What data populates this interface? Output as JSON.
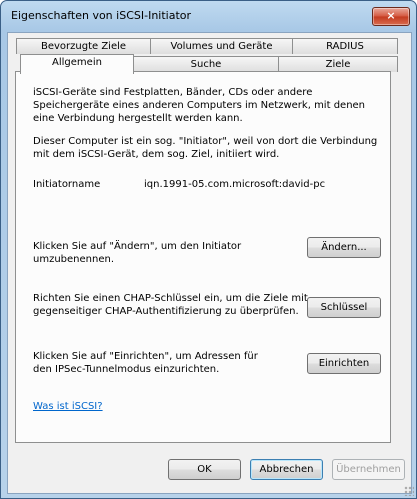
{
  "window": {
    "title": "Eigenschaften von iSCSI-Initiator",
    "close_glyph": "×"
  },
  "tabs": {
    "row_back": [
      "Bevorzugte Ziele",
      "Volumes und Geräte",
      "RADIUS"
    ],
    "row_front": [
      "Allgemein",
      "Suche",
      "Ziele"
    ],
    "active": "Allgemein"
  },
  "general": {
    "intro": "iSCSI-Geräte sind Festplatten, Bänder, CDs oder andere Speichergeräte eines anderen Computers im Netzwerk, mit denen eine Verbindung hergestellt werden kann.",
    "initiator_desc": "Dieser Computer ist ein sog. \"Initiator\", weil von dort die Verbindung mit dem iSCSI-Gerät, dem sog. Ziel, initiiert wird.",
    "initiator_name_label": "Initiatorname",
    "initiator_name_value": "iqn.1991-05.com.microsoft:david-pc",
    "rename_desc": "Klicken Sie auf \"Ändern\", um den Initiator umzubenennen.",
    "rename_button": "Ändern...",
    "chap_desc": "Richten Sie einen CHAP-Schlüssel ein, um die Ziele mit gegenseitiger CHAP-Authentifizierung zu überprüfen.",
    "chap_button": "Schlüssel",
    "ipsec_desc": "Klicken Sie auf \"Einrichten\", um Adressen für den IPSec-Tunnelmodus einzurichten.",
    "ipsec_button": "Einrichten",
    "help_link": "Was ist iSCSI?"
  },
  "footer": {
    "ok": "OK",
    "cancel": "Abbrechen",
    "apply": "Übernehmen"
  },
  "colors": {
    "link": "#0066cc",
    "title_frame": "#a8c8e6",
    "close_button": "#c43a1f"
  }
}
